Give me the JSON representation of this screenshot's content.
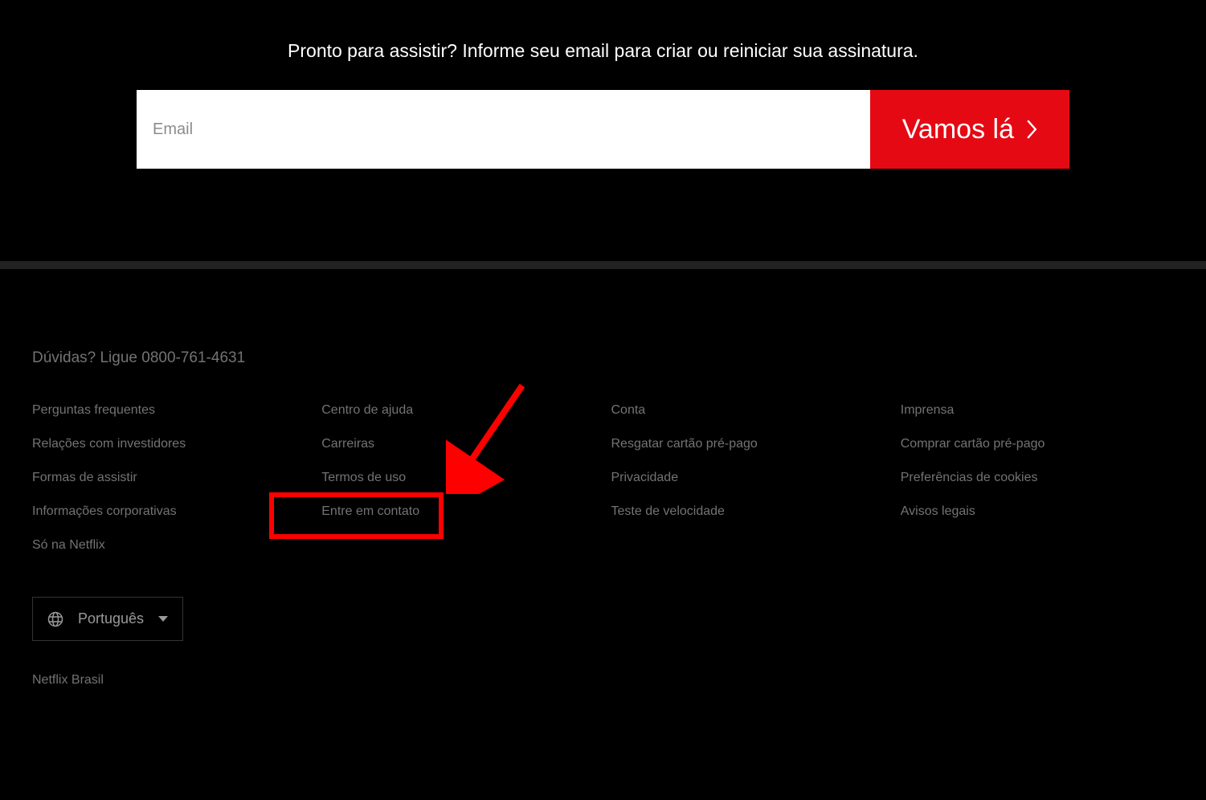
{
  "hero": {
    "cta_text": "Pronto para assistir? Informe seu email para criar ou reiniciar sua assinatura.",
    "email_placeholder": "Email",
    "button_label": "Vamos lá"
  },
  "footer": {
    "contact_text": "Dúvidas? Ligue 0800-761-4631",
    "links": {
      "col1": [
        "Perguntas frequentes",
        "Relações com investidores",
        "Formas de assistir",
        "Informações corporativas",
        "Só na Netflix"
      ],
      "col2": [
        "Centro de ajuda",
        "Carreiras",
        "Termos de uso",
        "Entre em contato"
      ],
      "col3": [
        "Conta",
        "Resgatar cartão pré-pago",
        "Privacidade",
        "Teste de velocidade"
      ],
      "col4": [
        "Imprensa",
        "Comprar cartão pré-pago",
        "Preferências de cookies",
        "Avisos legais"
      ]
    },
    "language": "Português",
    "brand": "Netflix Brasil"
  },
  "annotation": {
    "highlight_target": "Entre em contato"
  }
}
